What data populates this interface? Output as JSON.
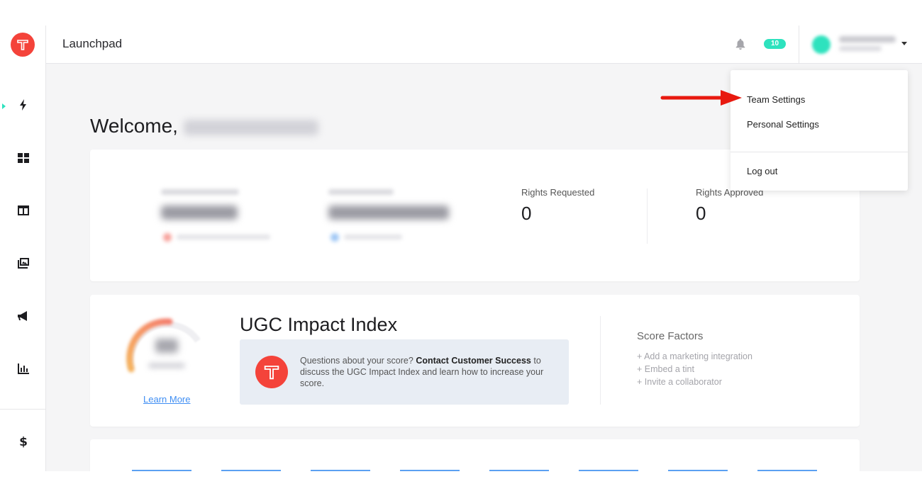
{
  "app": {
    "logo_letter": "T",
    "accent_color": "#2ee2be",
    "brand_color": "#f4433a"
  },
  "header": {
    "title": "Launchpad",
    "notification_count": "10"
  },
  "sidebar": {
    "items": [
      {
        "icon": "lightning-icon",
        "active": true
      },
      {
        "icon": "grid-icon"
      },
      {
        "icon": "layout-icon"
      },
      {
        "icon": "gallery-icon"
      },
      {
        "icon": "megaphone-icon"
      },
      {
        "icon": "bar-chart-icon"
      },
      {
        "icon": "dollar-icon"
      }
    ]
  },
  "welcome": {
    "greeting": "Welcome,"
  },
  "stats": {
    "rights_requested": {
      "label": "Rights Requested",
      "value": "0"
    },
    "rights_approved": {
      "label": "Rights Approved",
      "value": "0"
    }
  },
  "impact": {
    "title": "UGC Impact Index",
    "learn_more": "Learn More",
    "question_text": "Questions about your score?",
    "contact_link": "Contact Customer Success",
    "after_text": "to discuss the UGC Impact Index and learn how to increase your score.",
    "score_factors_title": "Score Factors",
    "score_factors": [
      "+ Add a marketing integration",
      "+ Embed a tint",
      "+ Invite a collaborator"
    ]
  },
  "dropdown": {
    "items": [
      "Team Settings",
      "Personal Settings"
    ],
    "logout": "Log out"
  }
}
